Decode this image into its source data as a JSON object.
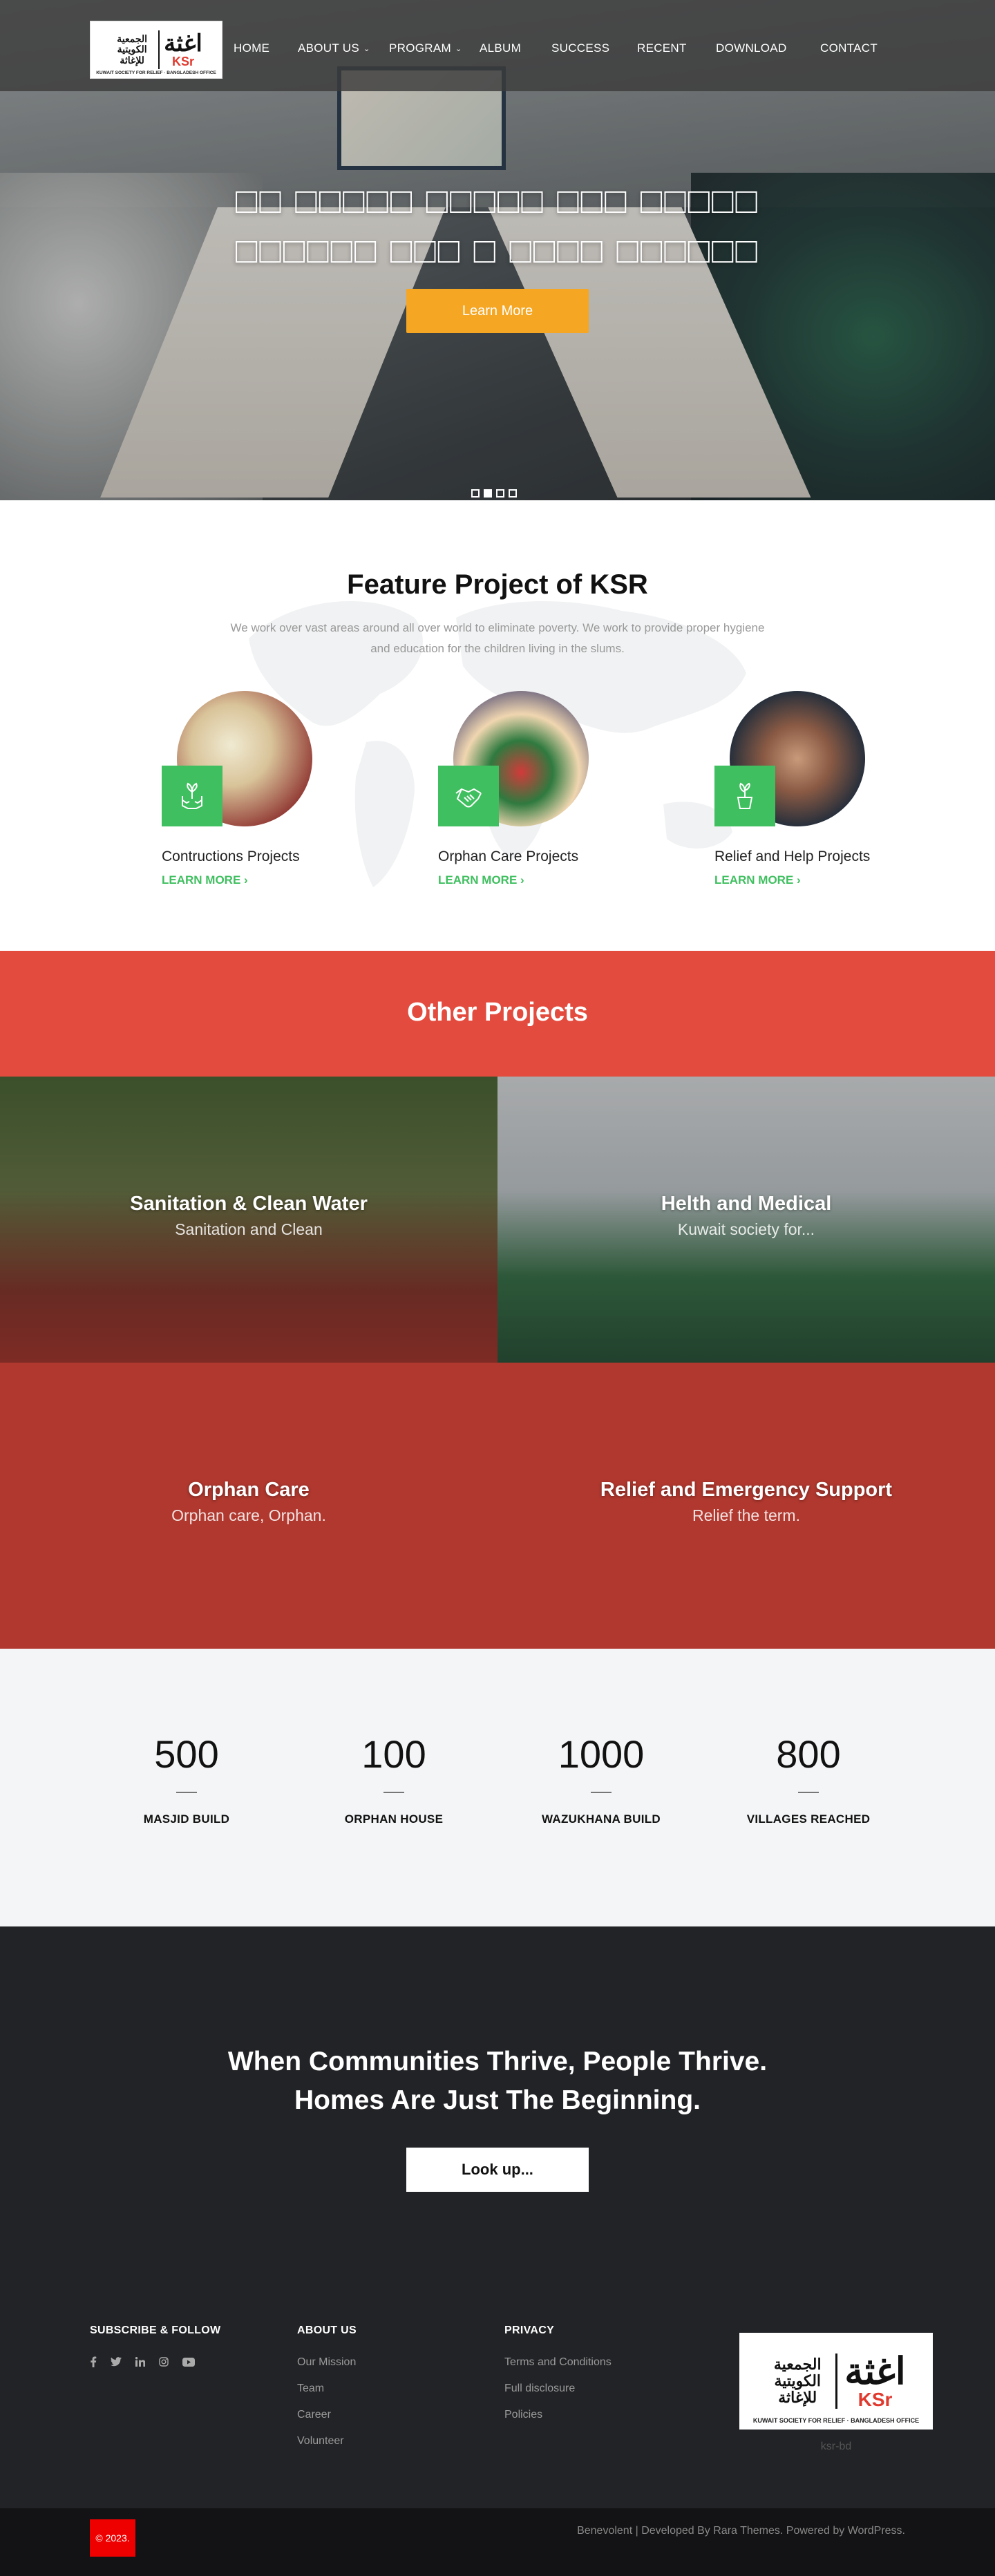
{
  "logo": {
    "arabic_name": "الجمعية الكويتية للإغاثة",
    "arabic_mark": "اغثة",
    "ksr": "KSr",
    "subtitle": "KUWAIT SOCIETY FOR RELIEF · BANGLADESH OFFICE"
  },
  "nav": {
    "items": [
      "HOME",
      "ABOUT US",
      "PROGRAM",
      "ALBUM",
      "SUCCESS",
      "RECENT",
      "DOWNLOAD",
      "CONTACT"
    ],
    "dropdown_items": [
      "ABOUT US",
      "PROGRAM"
    ]
  },
  "hero": {
    "title": "□□ □□□□□ □□□□□ □□□ □□□□□ □□□□□□ □□□ □ □□□□ □□□□□□",
    "button": "Learn More",
    "slides": 4,
    "active_slide": 2
  },
  "features": {
    "title": "Feature Project of KSR",
    "description": "We work over vast areas around all over world to eliminate poverty. We work to provide proper hygiene and education for the children living in the slums.",
    "items": [
      {
        "name": "Contructions Projects",
        "link": "LEARN MORE",
        "icon": "hands-plant-icon"
      },
      {
        "name": "Orphan Care Projects",
        "link": "LEARN MORE",
        "icon": "handshake-icon"
      },
      {
        "name": "Relief and Help Projects",
        "link": "LEARN MORE",
        "icon": "potted-plant-icon"
      }
    ]
  },
  "other_projects": {
    "title": "Other Projects",
    "items": [
      {
        "title": "Sanitation & Clean Water",
        "subtitle": "Sanitation and Clean"
      },
      {
        "title": "Helth and Medical",
        "subtitle": "Kuwait society for..."
      },
      {
        "title": "Orphan Care",
        "subtitle": "Orphan care, Orphan."
      },
      {
        "title": "Relief and Emergency Support",
        "subtitle": "Relief the term."
      }
    ]
  },
  "stats": [
    {
      "value": "500",
      "label": "MASJID BUILD"
    },
    {
      "value": "100",
      "label": "ORPHAN HOUSE"
    },
    {
      "value": "1000",
      "label": "WAZUKHANA BUILD"
    },
    {
      "value": "800",
      "label": "VILLAGES REACHED"
    }
  ],
  "cta": {
    "line1": "When Communities Thrive, People Thrive.",
    "line2": "Homes Are Just The Beginning.",
    "button": "Look up..."
  },
  "footer": {
    "subscribe_title": "SUBSCRIBE & FOLLOW",
    "social_icons": [
      "facebook-icon",
      "twitter-icon",
      "linkedin-icon",
      "instagram-icon",
      "youtube-icon"
    ],
    "about_title": "ABOUT US",
    "about_links": [
      "Our Mission",
      "Team",
      "Career",
      "Volunteer"
    ],
    "privacy_title": "PRIVACY",
    "privacy_links": [
      "Terms and Conditions",
      "Full disclosure",
      "Policies"
    ],
    "logo_caption": "ksr-bd",
    "copyright": "© 2023.",
    "credits": "Benevolent | Developed By Rara Themes. Powered by WordPress."
  },
  "colors": {
    "accent_orange": "#f5a623",
    "green": "#3fbf5f",
    "red": "#e34b3e",
    "dark_red": "#b0382f",
    "dark_bg": "#222326"
  }
}
